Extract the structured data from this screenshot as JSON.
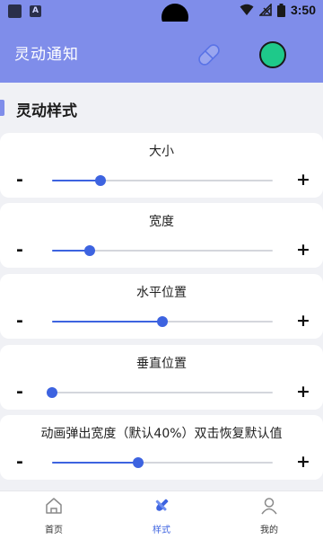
{
  "status_bar": {
    "time": "3:50",
    "notification_icons": [
      "app-notification-icon",
      "a-notification-icon"
    ],
    "system_icons": [
      "wifi-icon",
      "signal-icon",
      "battery-icon"
    ]
  },
  "app_bar": {
    "title": "灵动通知",
    "accent_color": "#7f8dea",
    "status_color": "#1ec98a"
  },
  "section": {
    "title": "灵动样式"
  },
  "sliders": [
    {
      "label": "大小",
      "minus": "-",
      "plus": "+",
      "value": 0.22
    },
    {
      "label": "宽度",
      "minus": "-",
      "plus": "+",
      "value": 0.17
    },
    {
      "label": "水平位置",
      "minus": "-",
      "plus": "+",
      "value": 0.5
    },
    {
      "label": "垂直位置",
      "minus": "-",
      "plus": "+",
      "value": 0.0
    },
    {
      "label": "动画弹出宽度（默认40%）双击恢复默认值",
      "minus": "-",
      "plus": "+",
      "value": 0.39
    }
  ],
  "slider_color": "#3d63e0",
  "bottom_nav": {
    "items": [
      {
        "label": "首页",
        "icon": "home-icon",
        "active": false
      },
      {
        "label": "样式",
        "icon": "brush-icon",
        "active": true
      },
      {
        "label": "我的",
        "icon": "profile-icon",
        "active": false
      }
    ]
  }
}
